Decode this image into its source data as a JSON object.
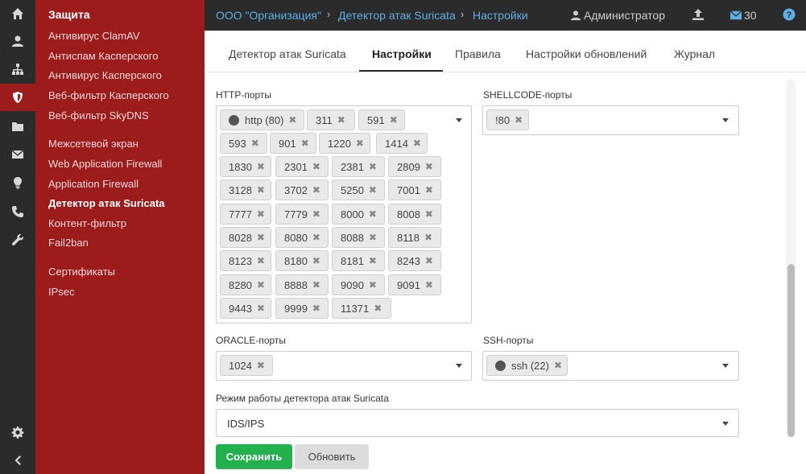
{
  "sidebar": {
    "title": "Защита",
    "items": [
      "Антивирус ClamAV",
      "Антиспам Касперского",
      "Антивирус Касперского",
      "Веб-фильтр Касперского",
      "Веб-фильтр SkyDNS",
      "Межсетевой экран",
      "Web Application Firewall",
      "Application Firewall",
      "Детектор атак Suricata",
      "Контент-фильтр",
      "Fail2ban",
      "Сертификаты",
      "IPsec"
    ],
    "active_item": "Детектор атак Suricata"
  },
  "rail": {
    "icons": [
      "home-icon",
      "user-icon",
      "network-icon",
      "shield-icon",
      "folder-icon",
      "mail-icon",
      "lightbulb-icon",
      "phone-icon",
      "wrench-icon",
      "gear-icon",
      "chevron-left-icon"
    ],
    "active": "shield-icon"
  },
  "breadcrumb": [
    "ООО \"Организация\"",
    "Детектор атак Suricata",
    "Настройки"
  ],
  "topbar": {
    "user": "Администратор",
    "messages_count": "30"
  },
  "tabs": [
    "Детектор атак Suricata",
    "Настройки",
    "Правила",
    "Настройки обновлений",
    "Журнал"
  ],
  "active_tab": "Настройки",
  "form": {
    "http_ports": {
      "label": "HTTP-порты",
      "tags": [
        "http (80)",
        "311",
        "591",
        "593",
        "901",
        "1220",
        "1414",
        "1830",
        "2301",
        "2381",
        "2809",
        "3128",
        "3702",
        "5250",
        "7001",
        "7777",
        "7779",
        "8000",
        "8008",
        "8028",
        "8080",
        "8088",
        "8118",
        "8123",
        "8180",
        "8181",
        "8243",
        "8280",
        "8888",
        "9090",
        "9091",
        "9443",
        "9999",
        "11371"
      ]
    },
    "shellcode_ports": {
      "label": "SHELLCODE-порты",
      "tags": [
        "!80"
      ]
    },
    "oracle_ports": {
      "label": "ORACLE-порты",
      "tags": [
        "1024"
      ]
    },
    "ssh_ports": {
      "label": "SSH-порты",
      "tags": [
        "ssh (22)"
      ]
    },
    "mode": {
      "label": "Режим работы детектора атак Suricata",
      "value": "IDS/IPS"
    }
  },
  "buttons": {
    "save": "Сохранить",
    "refresh": "Обновить"
  },
  "colors": {
    "sidebar": "#9c1b1b",
    "rail": "#2b2b2b",
    "save": "#22b14c",
    "link": "#5eaee6"
  }
}
